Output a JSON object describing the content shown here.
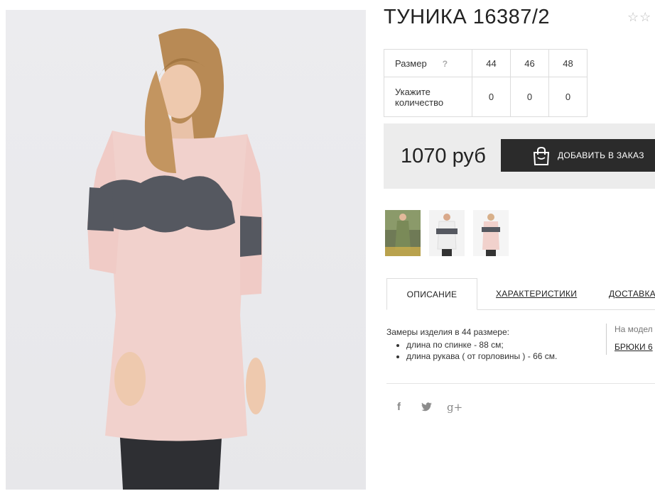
{
  "product": {
    "title": "ТУНИКА 16387/2",
    "rating_stars": "☆☆"
  },
  "size_table": {
    "size_label": "Размер",
    "help": "?",
    "sizes": [
      "44",
      "46",
      "48"
    ],
    "qty_label": "Укажите количество",
    "quantities": [
      "0",
      "0",
      "0"
    ]
  },
  "order": {
    "price": "1070 руб",
    "button_label": "ДОБАВИТЬ В ЗАКАЗ",
    "icon": "shopping-bag-icon"
  },
  "thumbnails": [
    {
      "color": "#7a8a58",
      "icon": "thumbnail-olive"
    },
    {
      "color": "#eeeeee",
      "icon": "thumbnail-white"
    },
    {
      "color": "#f1d1cc",
      "icon": "thumbnail-pink"
    }
  ],
  "tabs": [
    {
      "label": "ОПИСАНИЕ",
      "active": true
    },
    {
      "label": "ХАРАКТЕРИСТИКИ",
      "active": false
    },
    {
      "label": "ДОСТАВКА",
      "active": false
    }
  ],
  "description": {
    "intro": "Замеры изделия в 44 размере:",
    "items": [
      "длина по спинке - 88 см;",
      "длина рукава ( от горловины ) - 66 см."
    ]
  },
  "model_note": {
    "line1": "На модел",
    "line2": "БРЮКИ 6"
  },
  "social": [
    {
      "icon": "facebook-icon",
      "glyph": "f"
    },
    {
      "icon": "twitter-icon",
      "glyph": "🐦"
    },
    {
      "icon": "google-plus-icon",
      "glyph": "g+"
    }
  ],
  "colors": {
    "button_bg": "#2b2b2b",
    "price_band_bg": "#ececec",
    "tunic": "#f1d1cc",
    "lace": "#555860"
  }
}
